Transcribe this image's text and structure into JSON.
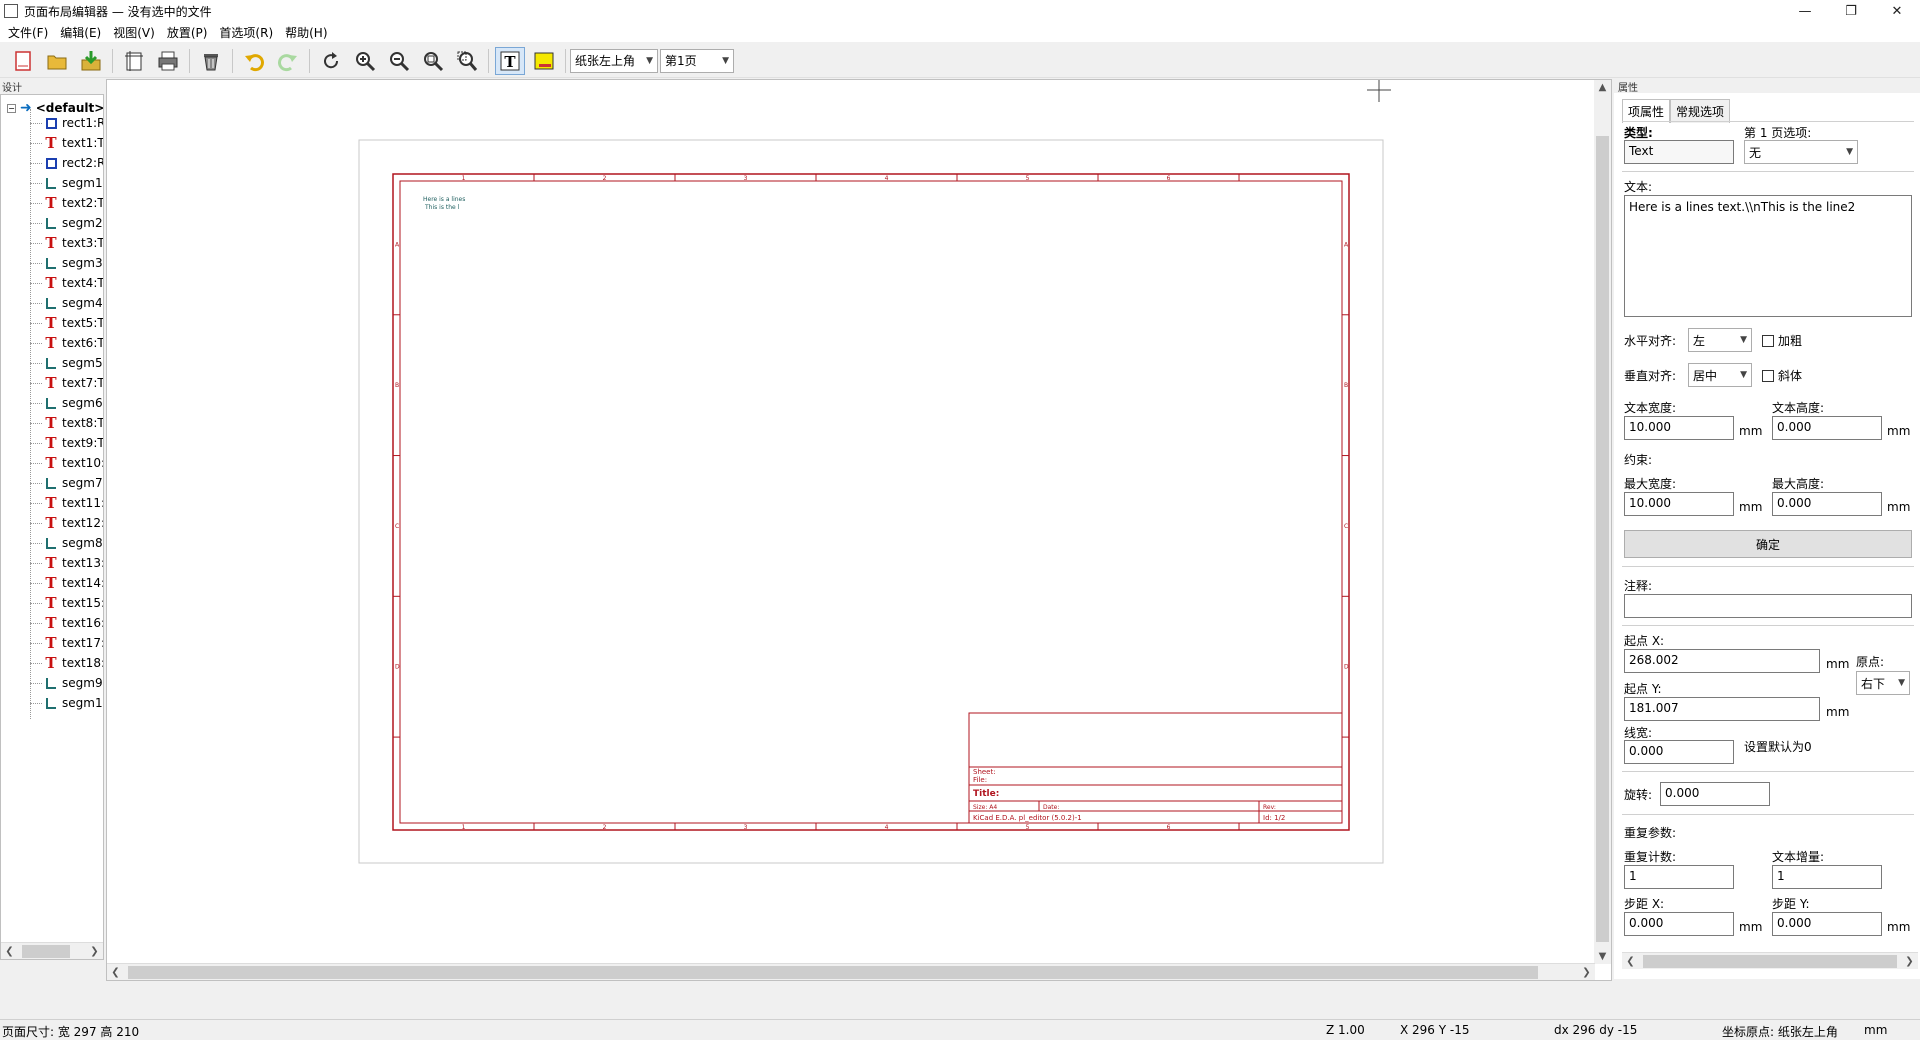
{
  "window": {
    "title": "页面布局编辑器 — 没有选中的文件",
    "controls": [
      "—",
      "❐",
      "✕"
    ]
  },
  "menu": [
    "文件(F)",
    "编辑(E)",
    "视图(V)",
    "放置(P)",
    "首选项(R)",
    "帮助(H)"
  ],
  "toolbar": {
    "origin_combo": "纸张左上角",
    "page_combo": "第1页"
  },
  "left_panel": {
    "caption": "设计",
    "root": "<default>",
    "items": [
      {
        "type": "rect",
        "label": "rect1:R"
      },
      {
        "type": "text",
        "label": "text1:T"
      },
      {
        "type": "rect",
        "label": "rect2:R"
      },
      {
        "type": "segm",
        "label": "segm1"
      },
      {
        "type": "text",
        "label": "text2:T"
      },
      {
        "type": "segm",
        "label": "segm2"
      },
      {
        "type": "text",
        "label": "text3:T"
      },
      {
        "type": "segm",
        "label": "segm3"
      },
      {
        "type": "text",
        "label": "text4:T"
      },
      {
        "type": "segm",
        "label": "segm4"
      },
      {
        "type": "text",
        "label": "text5:T"
      },
      {
        "type": "text",
        "label": "text6:T"
      },
      {
        "type": "segm",
        "label": "segm5"
      },
      {
        "type": "text",
        "label": "text7:T"
      },
      {
        "type": "segm",
        "label": "segm6"
      },
      {
        "type": "text",
        "label": "text8:T"
      },
      {
        "type": "text",
        "label": "text9:T"
      },
      {
        "type": "text",
        "label": "text10:"
      },
      {
        "type": "segm",
        "label": "segm7"
      },
      {
        "type": "text",
        "label": "text11:"
      },
      {
        "type": "text",
        "label": "text12:"
      },
      {
        "type": "segm",
        "label": "segm8"
      },
      {
        "type": "text",
        "label": "text13:"
      },
      {
        "type": "text",
        "label": "text14:"
      },
      {
        "type": "text",
        "label": "text15:"
      },
      {
        "type": "text",
        "label": "text16:"
      },
      {
        "type": "text",
        "label": "text17:"
      },
      {
        "type": "text",
        "label": "text18:"
      },
      {
        "type": "segm",
        "label": "segm9"
      },
      {
        "type": "segm",
        "label": "segm1"
      }
    ]
  },
  "sheet": {
    "top_numbers": [
      "1",
      "2",
      "3",
      "4",
      "5",
      "6"
    ],
    "side_letters": [
      "A",
      "B",
      "C",
      "D"
    ],
    "sample_text_1": "Here is a lines",
    "sample_text_2": "This is the l",
    "title_block": {
      "sheet": "Sheet:",
      "file": "File:",
      "title": "Title:",
      "size": "Size: A4",
      "date": "Date:",
      "rev": "Rev:",
      "kicad": "KiCad E.D.A.  pl_editor (5.0.2)-1",
      "id": "Id: 1/2"
    }
  },
  "right_panel": {
    "caption": "属性",
    "tabs": [
      "项属性",
      "常规选项"
    ],
    "type_label": "类型:",
    "type_value": "Text",
    "page_opt_label": "第 1 页选项:",
    "page_opt_value": "无",
    "text_label": "文本:",
    "text_value": "Here is a lines text.\\\\nThis is the line2",
    "halign_label": "水平对齐:",
    "halign_value": "左",
    "bold_label": "加粗",
    "valign_label": "垂直对齐:",
    "valign_value": "居中",
    "italic_label": "斜体",
    "text_width_label": "文本宽度:",
    "text_width_value": "10.000",
    "text_height_label": "文本高度:",
    "text_height_value": "0.000",
    "unit": "mm",
    "constraints_label": "约束:",
    "max_width_label": "最大宽度:",
    "max_width_value": "10.000",
    "max_height_label": "最大高度:",
    "max_height_value": "0.000",
    "ok_button": "确定",
    "comment_label": "注释:",
    "comment_value": "",
    "start_x_label": "起点 X:",
    "start_x_value": "268.002",
    "origin_label": "原点:",
    "origin_value": "右下",
    "start_y_label": "起点 Y:",
    "start_y_value": "181.007",
    "linewidth_label": "线宽:",
    "linewidth_value": "0.000",
    "default_zero_note": "设置默认为0",
    "rotation_label": "旋转:",
    "rotation_value": "0.000",
    "repeat_label": "重复参数:",
    "repeat_count_label": "重复计数:",
    "repeat_count_value": "1",
    "text_incr_label": "文本增量:",
    "text_incr_value": "1",
    "step_x_label": "步距 X:",
    "step_x_value": "0.000",
    "step_y_label": "步距 Y:",
    "step_y_value": "0.000"
  },
  "status": {
    "page_size": "页面尺寸: 宽 297 高 210",
    "zoom": "Z 1.00",
    "xy": "X 296  Y -15",
    "dxy": "dx 296  dy -15",
    "origin": "坐标原点: 纸张左上角",
    "units": "mm"
  },
  "colors": {
    "frame": "#b0151f",
    "accent": "#0078d7",
    "sample_text": "#1f5f5f"
  }
}
